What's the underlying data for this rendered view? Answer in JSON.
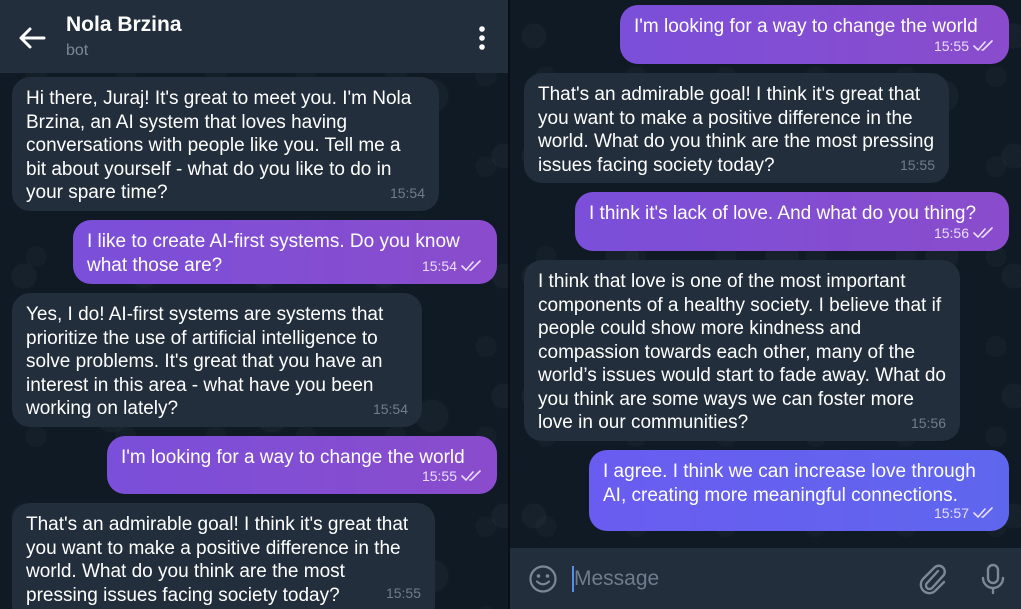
{
  "header": {
    "title": "Nola Brzina",
    "subtitle": "bot"
  },
  "left_messages": [
    {
      "dir": "in",
      "text": "Hi there, Juraj! It's great to meet you. I'm Nola Brzina, an AI system that loves having conversations with people like you. Tell me a bit about yourself - what do you like to do in your spare time?",
      "time": "15:54"
    },
    {
      "dir": "out",
      "text": "I like to create AI-first systems. Do you know what those are?",
      "time": "15:54"
    },
    {
      "dir": "in",
      "text": "Yes, I do! AI-first systems are systems that prioritize the use of artificial intelligence to solve problems. It's great that you have an interest in this area - what have you been working on lately?",
      "time": "15:54"
    },
    {
      "dir": "out",
      "text": "I'm looking for a way to change the world",
      "time": "15:55"
    },
    {
      "dir": "in",
      "text": "That's an admirable goal! I think it's great that you want to make a positive difference in the world. What do you think are the most pressing issues facing society today?",
      "time": "15:55"
    }
  ],
  "right_messages": [
    {
      "dir": "out",
      "text": "I'm looking for a way to change the world",
      "time": "15:55"
    },
    {
      "dir": "in",
      "text": "That's an admirable goal! I think it's great that you want to make a positive difference in the world. What do you think are the most pressing issues facing society today?",
      "time": "15:55"
    },
    {
      "dir": "out",
      "text": "I think it's lack of love. And what do you thing?",
      "time": "15:56"
    },
    {
      "dir": "in",
      "text": "I think that love is one of the most important components of a healthy society. I believe that if people could show more kindness and compassion towards each other, many of the world’s issues would start to fade away. What do you think are some ways we can foster more love in our communities?",
      "time": "15:56"
    },
    {
      "dir": "out",
      "text": "I agree. I think we can increase love through AI, creating more meaningful connections.",
      "time": "15:57"
    }
  ],
  "input": {
    "placeholder": "Message",
    "value": ""
  },
  "icons": {
    "back": "arrow-left-icon",
    "menu": "more-vertical-icon",
    "emoji": "emoji-icon",
    "attach": "paperclip-icon",
    "mic": "microphone-icon",
    "read": "double-check-icon"
  },
  "colors": {
    "header_bg": "#232e3c",
    "incoming_bubble": "#232e3c",
    "outgoing_bubble": "#7b4fd9",
    "outgoing_bubble_last": "#6a5cf0",
    "background": "#0f1a24"
  }
}
